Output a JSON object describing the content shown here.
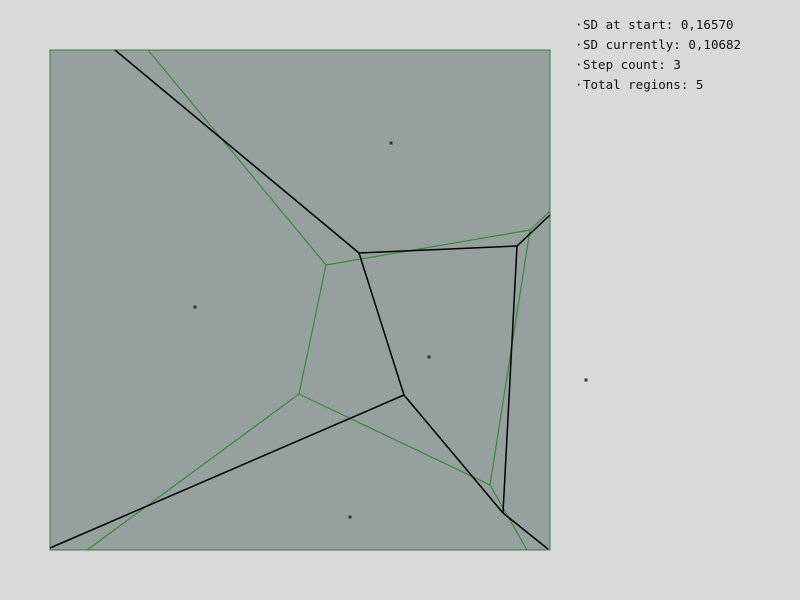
{
  "stats": {
    "bullet": "·",
    "sd_start_label": "SD at start:",
    "sd_start_value": "0,16570",
    "sd_current_label": "SD currently:",
    "sd_current_value": "0,10682",
    "step_count_label": "Step count:",
    "step_count_value": "3",
    "total_regions_label": "Total regions:",
    "total_regions_value": "5"
  },
  "colors": {
    "background": "#d9d9d9",
    "square_fill": "#96a09e",
    "square_border": "#3a7a3a",
    "initial_edges": "#3a8a3a",
    "current_edges": "#000000",
    "site_points": "#0d4a36"
  }
}
